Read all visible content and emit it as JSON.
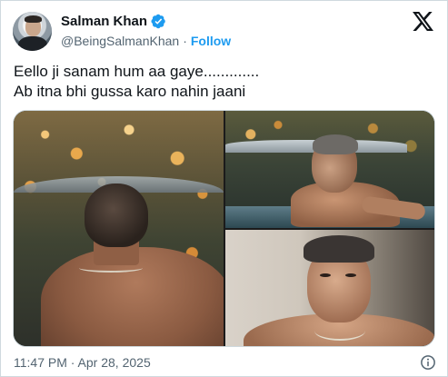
{
  "author": {
    "display_name": "Salman Khan",
    "handle": "@BeingSalmanKhan",
    "separator": "·",
    "follow_label": "Follow",
    "verified": true,
    "avatar_icon": "profile-photo"
  },
  "tweet": {
    "text": "Eello ji sanam hum aa gaye.............\nAb itna bhi gussa karo nahin jaani",
    "timestamp": "11:47 PM · Apr 28, 2025"
  },
  "media": {
    "count": 3
  },
  "icons": {
    "brand": "x-logo-icon",
    "verified": "verified-badge-icon",
    "info": "info-icon"
  },
  "colors": {
    "accent": "#1d9bf0",
    "text": "#0f1419",
    "secondary": "#536471",
    "border": "#cfd9de"
  }
}
